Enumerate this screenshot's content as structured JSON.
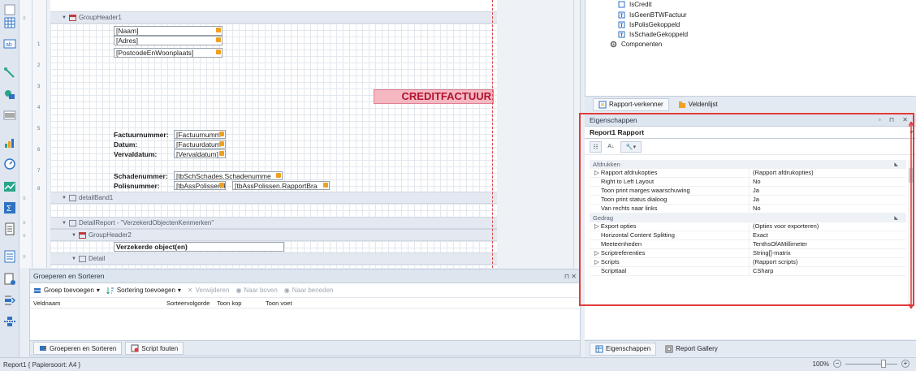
{
  "design": {
    "bands": {
      "group_header1": "GroupHeader1",
      "detail_band1": "detailBand1",
      "detail_report": "DetailReport - \"VerzekerdObjectenKenmerken\"",
      "group_header2": "GroupHeader2",
      "detail": "Detail"
    },
    "fields": {
      "naam": "[Naam]",
      "adres": "[Adres]",
      "postcode": "[PostcodeEnWoonplaats]",
      "factuurnummer_value": "[Factuurnumm",
      "datum_value": "[Factuurdatum",
      "vervaldatum_value": "[Vervaldatum]",
      "schadenummer_value": "[tbSchSchades.Schadenumme",
      "polis_value1": "[tbAssPolissen.P",
      "polis_value2": "[tbAssPolissen.RapportBra"
    },
    "labels": {
      "creditfactuur": "CREDITFACTUUR",
      "factuurnummer": "Factuurnummer:",
      "datum": "Datum:",
      "vervaldatum": "Vervaldatum:",
      "schadenummer": "Schadenummer:",
      "polisnummer": "Polisnummer:",
      "verzekerde": "Verzekerde object(en)"
    },
    "ruler": [
      "1",
      "2",
      "3",
      "4",
      "5",
      "6",
      "7",
      "8"
    ]
  },
  "grouping": {
    "title": "Groeperen en Sorteren",
    "toolbar": {
      "add_group": "Groep toevoegen",
      "add_sort": "Sortering toevoegen",
      "delete": "Verwijderen",
      "move_up": "Naar boven",
      "move_down": "Naar beneden"
    },
    "columns": [
      "Veldnaam",
      "Sorteervolgorde",
      "Toon kop",
      "Toon voet"
    ],
    "tabs": [
      "Groeperen en Sorteren",
      "Script fouten"
    ]
  },
  "explorer": {
    "items": [
      "IsCredit",
      "IsGeenBTWFactuur",
      "IsPolisGekoppeld",
      "IsSchadeGekoppeld",
      "Componenten"
    ],
    "tabs": [
      "Rapport-verkenner",
      "Veldenlijst"
    ]
  },
  "properties": {
    "title": "Eigenschappen",
    "object": "Report1",
    "object_type": "Rapport",
    "categories": {
      "afdrukken": "Afdrukken",
      "gedrag": "Gedrag"
    },
    "rows_afdrukken": [
      {
        "name": "Rapport afdrukopties",
        "value": "(Rapport afdrukopties)"
      },
      {
        "name": "Right to Left Layout",
        "value": "No"
      },
      {
        "name": "Toon print marges waarschuwing",
        "value": "Ja"
      },
      {
        "name": "Toon print status dialoog",
        "value": "Ja"
      },
      {
        "name": "Van rechts naar links",
        "value": "No"
      }
    ],
    "rows_gedrag": [
      {
        "name": "Export opties",
        "value": "(Opties voor exporteren)"
      },
      {
        "name": "Horizontal Content Splitting",
        "value": "Exact"
      },
      {
        "name": "Meeteenheden",
        "value": "TenthsOfAMillimeter"
      },
      {
        "name": "Scriptreferenties",
        "value": "String[]-matrix"
      },
      {
        "name": "Scripts",
        "value": "(Rapport scripts)"
      },
      {
        "name": "Scripttaal",
        "value": "CSharp"
      }
    ],
    "tabs": [
      "Eigenschappen",
      "Report Gallery"
    ]
  },
  "status": {
    "text": "Report1 { Papiersoort: A4 }",
    "zoom": "100%"
  },
  "colors": {
    "accent": "#e23b3b",
    "credit_bg": "#f5b8c3",
    "credit_text": "#b3122e",
    "field_tag": "#f0a020"
  }
}
